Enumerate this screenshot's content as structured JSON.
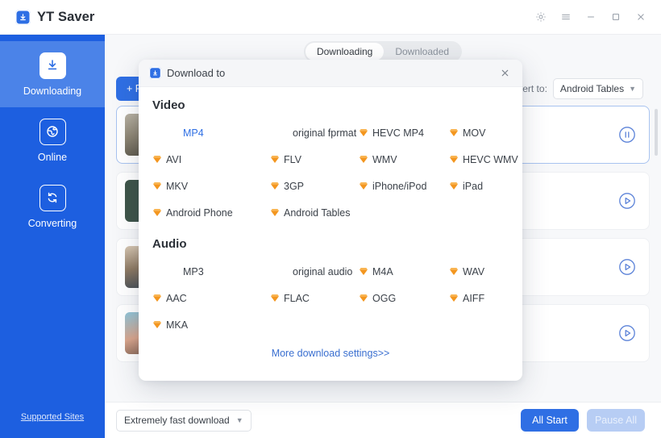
{
  "window": {
    "brand": "YT Saver",
    "brand_icon": "download-box-icon",
    "controls": [
      {
        "name": "settings-gear-icon",
        "glyph": "gear"
      },
      {
        "name": "menu-hamburger-icon",
        "glyph": "menu"
      },
      {
        "name": "minimize-icon",
        "glyph": "minimize"
      },
      {
        "name": "maximize-icon",
        "glyph": "maximize"
      },
      {
        "name": "close-icon",
        "glyph": "close"
      }
    ]
  },
  "sidebar": {
    "items": [
      {
        "label": "Downloading",
        "icon": "download-icon",
        "active": true
      },
      {
        "label": "Online",
        "icon": "globe-icon",
        "active": false
      },
      {
        "label": "Converting",
        "icon": "refresh-icon",
        "active": false
      }
    ],
    "footer_link": "Supported Sites"
  },
  "tabs": [
    {
      "label": "Downloading",
      "active": true
    },
    {
      "label": "Downloaded",
      "active": false
    }
  ],
  "toolbar": {
    "paste_label": "+ P",
    "convert_label": "nvert to:",
    "convert_value": "Android Tables"
  },
  "list": {
    "rows": [
      {
        "state": "downloading",
        "action": "pause-button",
        "selected": true
      },
      {
        "state": "paused",
        "action": "play-button",
        "selected": false
      },
      {
        "state": "paused",
        "action": "play-button",
        "selected": false
      },
      {
        "state": "paused",
        "action": "play-button",
        "selected": false
      }
    ]
  },
  "bottom": {
    "speed_value": "Extremely fast download",
    "all_start": "All Start",
    "pause_all": "Pause All"
  },
  "modal": {
    "title": "Download to",
    "title_icon": "download-box-icon",
    "close_icon": "close-icon",
    "more_link": "More download settings>>",
    "sections": [
      {
        "heading": "Video",
        "formats": [
          {
            "label": "MP4",
            "premium": false,
            "selected": true,
            "indent": 1
          },
          {
            "label": "original fprmat",
            "premium": false,
            "selected": false,
            "indent": 2
          },
          {
            "label": "HEVC MP4",
            "premium": true,
            "selected": false,
            "indent": 0
          },
          {
            "label": "MOV",
            "premium": true,
            "selected": false,
            "indent": 0
          },
          {
            "label": "AVI",
            "premium": true,
            "selected": false,
            "indent": 0
          },
          {
            "label": "FLV",
            "premium": true,
            "selected": false,
            "indent": 0
          },
          {
            "label": "WMV",
            "premium": true,
            "selected": false,
            "indent": 0
          },
          {
            "label": "HEVC WMV",
            "premium": true,
            "selected": false,
            "indent": 0
          },
          {
            "label": "MKV",
            "premium": true,
            "selected": false,
            "indent": 0
          },
          {
            "label": "3GP",
            "premium": true,
            "selected": false,
            "indent": 0
          },
          {
            "label": "iPhone/iPod",
            "premium": true,
            "selected": false,
            "indent": 0
          },
          {
            "label": "iPad",
            "premium": true,
            "selected": false,
            "indent": 0
          },
          {
            "label": "Android Phone",
            "premium": true,
            "selected": false,
            "indent": 0
          },
          {
            "label": "Android Tables",
            "premium": true,
            "selected": false,
            "indent": 0
          }
        ]
      },
      {
        "heading": "Audio",
        "formats": [
          {
            "label": "MP3",
            "premium": false,
            "selected": false,
            "indent": 1
          },
          {
            "label": "original audio",
            "premium": false,
            "selected": false,
            "indent": 2
          },
          {
            "label": "M4A",
            "premium": true,
            "selected": false,
            "indent": 0
          },
          {
            "label": "WAV",
            "premium": true,
            "selected": false,
            "indent": 0
          },
          {
            "label": "AAC",
            "premium": true,
            "selected": false,
            "indent": 0
          },
          {
            "label": "FLAC",
            "premium": true,
            "selected": false,
            "indent": 0
          },
          {
            "label": "OGG",
            "premium": true,
            "selected": false,
            "indent": 0
          },
          {
            "label": "AIFF",
            "premium": true,
            "selected": false,
            "indent": 0
          },
          {
            "label": "MKA",
            "premium": true,
            "selected": false,
            "indent": 0
          }
        ]
      }
    ]
  },
  "colors": {
    "accent": "#2f6fe4",
    "sidebar": "#1d5fe0",
    "sidebar_active": "#4b83e8",
    "premium_gem": "#f3961f",
    "selected_text": "#2f6fe4"
  }
}
